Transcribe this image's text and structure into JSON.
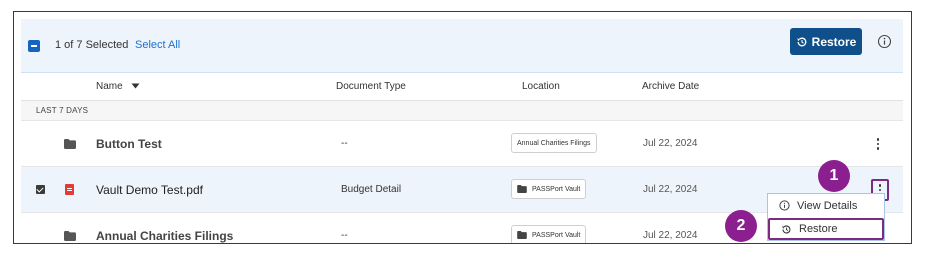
{
  "toolbar": {
    "selected_text": "1 of 7 Selected",
    "select_all_label": "Select All",
    "restore_label": "Restore"
  },
  "columns": {
    "name": "Name",
    "document_type": "Document Type",
    "location": "Location",
    "archive_date": "Archive Date"
  },
  "section_label": "LAST 7 DAYS",
  "rows": [
    {
      "name": "Button Test",
      "document_type": "--",
      "location": "Annual Charities Filings",
      "archive_date": "Jul 22, 2024",
      "selected": false,
      "icon": "folder-icon"
    },
    {
      "name": "Vault Demo Test.pdf",
      "document_type": "Budget Detail",
      "location": "PASSPort Vault",
      "archive_date": "Jul 22, 2024",
      "selected": true,
      "icon": "pdf-icon"
    },
    {
      "name": "Annual Charities Filings",
      "document_type": "--",
      "location": "PASSPort Vault",
      "archive_date": "Jul 22, 2024",
      "selected": false,
      "icon": "folder-icon"
    }
  ],
  "menu": {
    "view_details": "View Details",
    "restore": "Restore"
  },
  "callouts": [
    "1",
    "2"
  ],
  "colors": {
    "accent": "#0f4f8a",
    "link": "#1f6fd1",
    "callout": "#8b1f8f",
    "selected_row": "#eef4fb",
    "pdf": "#e53935"
  }
}
